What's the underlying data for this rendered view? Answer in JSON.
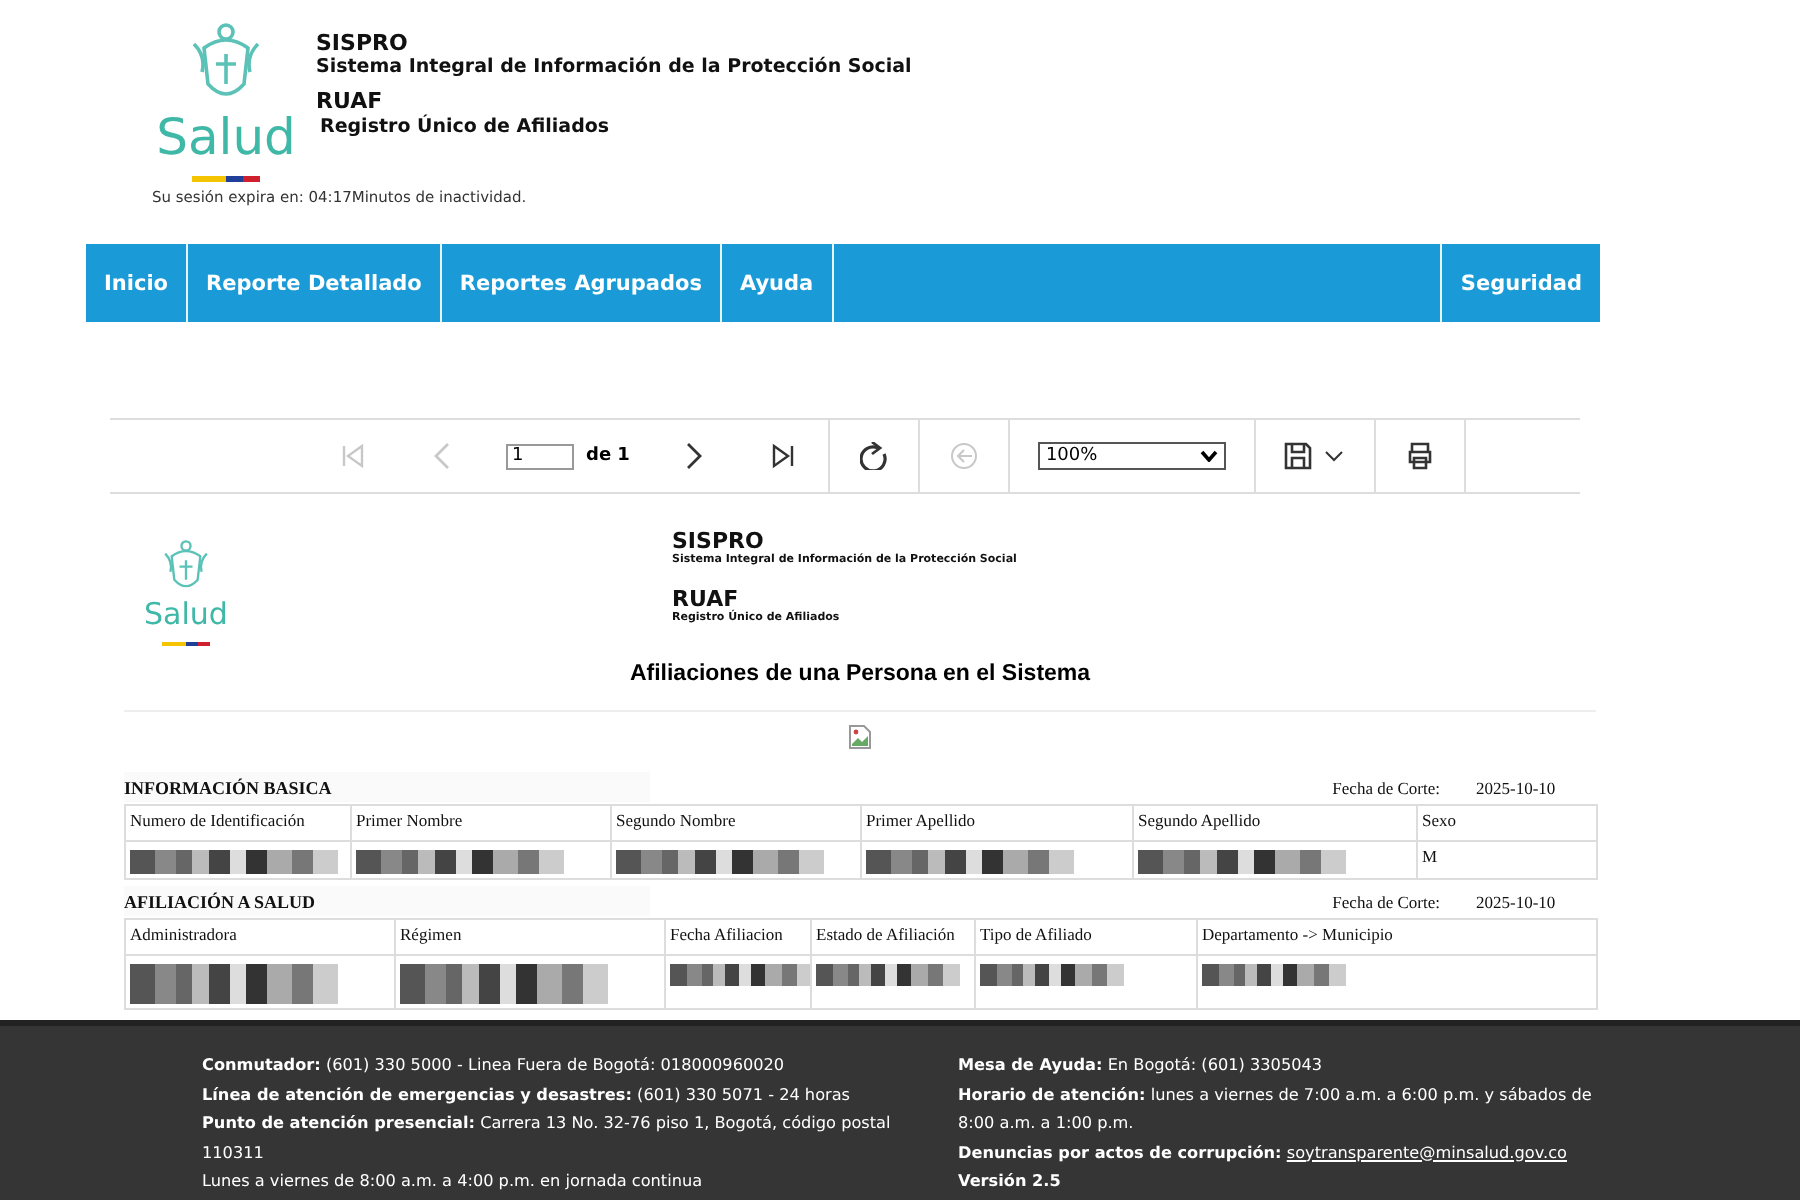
{
  "header": {
    "logo_text": "Salud",
    "system": "SISPRO",
    "system_full": "Sistema Integral de Información de la Protección Social",
    "module": "RUAF",
    "module_full": "Registro Único de Afiliados",
    "session_notice": "Su sesión expira en: 04:17Minutos de inactividad."
  },
  "nav": {
    "items": [
      "Inicio",
      "Reporte Detallado",
      "Reportes Agrupados",
      "Ayuda"
    ],
    "right_items": [
      "Seguridad"
    ]
  },
  "toolbar": {
    "page_value": "1",
    "page_total": "de 1",
    "zoom": "100%",
    "buttons": [
      {
        "kind": "first",
        "disabled": true
      },
      {
        "kind": "prev",
        "disabled": true
      },
      {
        "kind": "page"
      },
      {
        "kind": "next",
        "disabled": false
      },
      {
        "kind": "last",
        "disabled": false
      },
      {
        "kind": "refresh",
        "disabled": false
      },
      {
        "kind": "back",
        "disabled": true
      },
      {
        "kind": "zoom"
      },
      {
        "kind": "save",
        "disabled": false
      },
      {
        "kind": "print",
        "disabled": false
      }
    ]
  },
  "report": {
    "logo_text": "Salud",
    "system": "SISPRO",
    "system_full": "Sistema Integral de Información de la Protección Social",
    "module": "RUAF",
    "module_full": "Registro Único de Afiliados",
    "title": "Afiliaciones de una Persona en el Sistema",
    "sections": [
      {
        "title": "INFORMACIÓN BASICA",
        "cutoff_label": "Fecha de Corte:",
        "cutoff_date": "2025-10-10",
        "columns": [
          "Numero de Identificación",
          "Primer Nombre",
          "Segundo Nombre",
          "Primer Apellido",
          "Segundo Apellido",
          "Sexo"
        ],
        "rows": [
          [
            {
              "redacted": true
            },
            {
              "redacted": true
            },
            {
              "redacted": true
            },
            {
              "redacted": true
            },
            {
              "redacted": true
            },
            {
              "redacted": false,
              "text": "M"
            }
          ]
        ]
      },
      {
        "title": "AFILIACIÓN A SALUD",
        "cutoff_label": "Fecha de Corte:",
        "cutoff_date": "2025-10-10",
        "columns": [
          "Administradora",
          "Régimen",
          "Fecha Afiliacion",
          "Estado de Afiliación",
          "Tipo de Afiliado",
          "Departamento -> Municipio"
        ],
        "rows": [
          [
            {
              "redacted": true
            },
            {
              "redacted": true
            },
            {
              "redacted": true
            },
            {
              "redacted": true
            },
            {
              "redacted": true
            },
            {
              "redacted": true
            }
          ]
        ]
      }
    ]
  },
  "footer": {
    "left": [
      {
        "text": "**Conmutador:** (601) 330 5000 - Linea Fuera de Bogotá: 018000960020"
      },
      {
        "text": "**Línea de atención de emergencias y desastres:** (601) 330 5071 - 24 horas"
      },
      {
        "text": "**Punto de atención presencial:** Carrera 13 No. 32-76 piso 1, Bogotá, código postal 110311"
      },
      {
        "text": "Lunes a viernes de 8:00 a.m. a 4:00 p.m. en jornada continua"
      }
    ],
    "right": [
      {
        "text": "**Mesa de Ayuda:** En Bogotá: (601) 3305043"
      },
      {
        "text": "**Horario de atención:** lunes a viernes de 7:00 a.m. a 6:00 p.m. y sábados de 8:00 a.m. a 1:00 p.m."
      },
      {
        "text": "**Denuncias por actos de corrupción:**",
        "link": "soytransparente@minsalud.gov.co"
      },
      {
        "text": "**Versión 2.5**"
      }
    ]
  }
}
